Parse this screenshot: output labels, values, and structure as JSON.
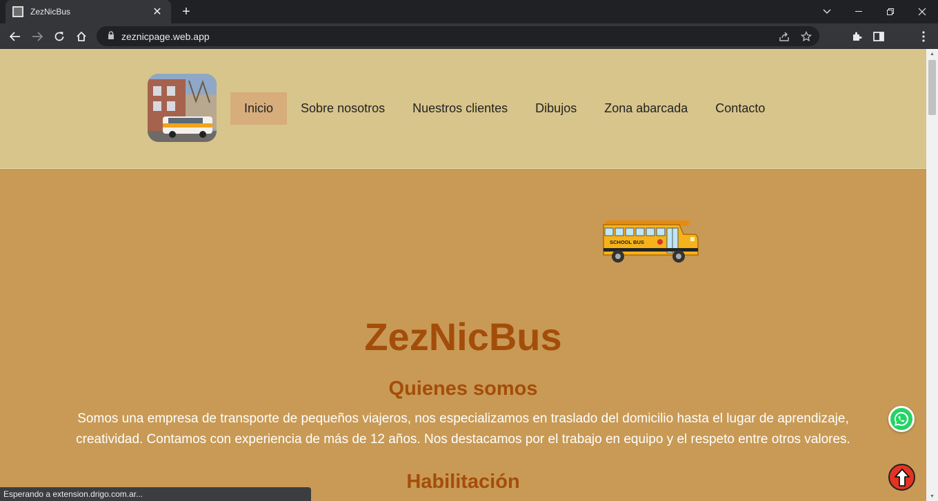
{
  "browser": {
    "tab_title": "ZezNicBus",
    "tab_close": "✕",
    "new_tab": "+",
    "url": "zeznicpage.web.app",
    "status_text": "Esperando a extension.drigo.com.ar..."
  },
  "nav": {
    "items": [
      "Inicio",
      "Sobre nosotros",
      "Nuestros clientes",
      "Dibujos",
      "Zona abarcada",
      "Contacto"
    ],
    "active": "Inicio"
  },
  "bus": {
    "sign": "SCHOOL BUS"
  },
  "hero": {
    "brand": "ZezNicBus",
    "about_title": "Quienes somos",
    "about_text": "Somos una empresa de transporte de pequeños viajeros, nos especializamos en traslado del domicilio hasta el lugar de aprendizaje, creatividad. Contamos con experiencia de más de 12 años. Nos destacamos por el trabajo en equipo y el respeto entre otros valores.",
    "habilitacion_title": "Habilitación"
  },
  "colors": {
    "header_bg": "#d8c58b",
    "page_bg": "#c89a55",
    "heading": "#a44d0b",
    "nav_active": "#d6ad7b",
    "whatsapp": "#25d366",
    "top_button": "#e53322"
  },
  "icons": {
    "whatsapp": "whatsapp-icon",
    "scroll_top": "arrow-up-icon"
  }
}
